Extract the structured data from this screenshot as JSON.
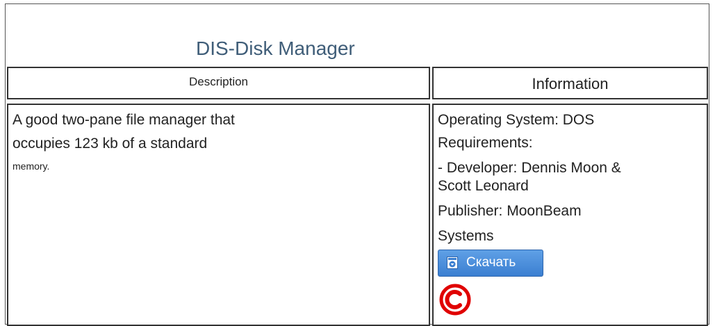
{
  "page": {
    "title": "DIS-Disk Manager"
  },
  "table": {
    "headers": {
      "description": "Description",
      "information": "Information"
    },
    "description_lines": [
      "A good two-pane file manager that",
      "occupies 123 kb of a standard",
      "memory."
    ],
    "information_lines": [
      "Operating System: DOS",
      "Requirements:",
      "- Developer: Dennis Moon &",
      "Scott Leonard",
      "Publisher: MoonBeam",
      "Systems"
    ],
    "download_button": {
      "label": "Скачать",
      "icon": "download-icon"
    },
    "copyright_icon": "copyright-icon"
  },
  "colors": {
    "title": "#3f5d78",
    "button": "#3b7fd1",
    "copyright": "#e00000"
  }
}
